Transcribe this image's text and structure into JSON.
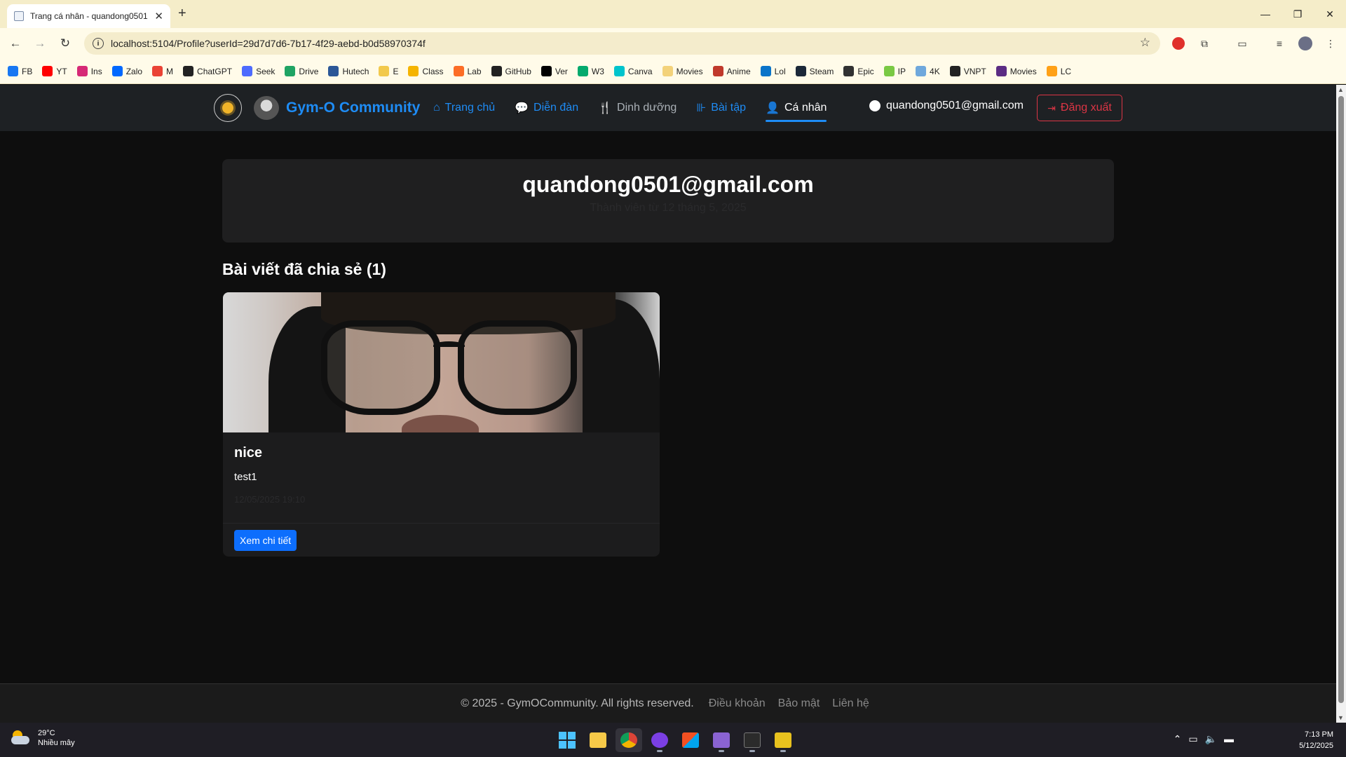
{
  "browser": {
    "tab_title": "Trang cá nhân - quandong0501",
    "url": "localhost:5104/Profile?userId=29d7d7d6-7b17-4f29-aebd-b0d58970374f",
    "bookmarks": [
      {
        "label": "FB",
        "color": "#1877f2"
      },
      {
        "label": "YT",
        "color": "#ff0000"
      },
      {
        "label": "Ins",
        "color": "#d62976"
      },
      {
        "label": "Zalo",
        "color": "#0068ff"
      },
      {
        "label": "M",
        "color": "#ea4335"
      },
      {
        "label": "ChatGPT",
        "color": "#222222"
      },
      {
        "label": "Seek",
        "color": "#4d6bfe"
      },
      {
        "label": "Drive",
        "color": "#1fa463"
      },
      {
        "label": "Hutech",
        "color": "#2b5797"
      },
      {
        "label": "E",
        "color": "#f2c94c"
      },
      {
        "label": "Class",
        "color": "#f5b400"
      },
      {
        "label": "Lab",
        "color": "#fc6d26"
      },
      {
        "label": "GitHub",
        "color": "#222222"
      },
      {
        "label": "Ver",
        "color": "#000000"
      },
      {
        "label": "W3",
        "color": "#04aa6d"
      },
      {
        "label": "Canva",
        "color": "#00c4cc"
      },
      {
        "label": "Movies",
        "color": "#f3d27a"
      },
      {
        "label": "Anime",
        "color": "#c0392b"
      },
      {
        "label": "Lol",
        "color": "#0a74c9"
      },
      {
        "label": "Steam",
        "color": "#1b2838"
      },
      {
        "label": "Epic",
        "color": "#313131"
      },
      {
        "label": "IP",
        "color": "#7ac943"
      },
      {
        "label": "4K",
        "color": "#6fa8dc"
      },
      {
        "label": "VNPT",
        "color": "#222222"
      },
      {
        "label": "Movies",
        "color": "#5b2c83"
      },
      {
        "label": "LC",
        "color": "#ffa116"
      }
    ]
  },
  "navbar": {
    "brand": "Gym-O Community",
    "links": [
      {
        "label": "Trang chủ",
        "icon": "home-icon",
        "glyph": "⌂",
        "style": "blue"
      },
      {
        "label": "Diễn đàn",
        "icon": "comments-icon",
        "glyph": "💬",
        "style": "blue"
      },
      {
        "label": "Dinh dưỡng",
        "icon": "utensils-icon",
        "glyph": "🍴",
        "style": "gray"
      },
      {
        "label": "Bài tập",
        "icon": "dumbbell-icon",
        "glyph": "⊪",
        "style": "blue"
      },
      {
        "label": "Cá nhân",
        "icon": "user-icon",
        "glyph": "👤",
        "style": "active"
      }
    ],
    "user_email": "quandong0501@gmail.com",
    "logout_label": "Đăng xuất",
    "accent": "#1e8cf5"
  },
  "profile": {
    "heading": "quandong0501@gmail.com",
    "subtitle": "Thành viên từ 12 tháng 5, 2025"
  },
  "posts_section": {
    "title": "Bài viết đã chia sẻ (1)"
  },
  "post": {
    "title": "nice",
    "content": "test1",
    "meta": "12/05/2025 19:10",
    "detail_button": "Xem chi tiết"
  },
  "footer": {
    "copyright": "© 2025 - GymOCommunity. All rights reserved.",
    "links": [
      "Điều khoản",
      "Bảo mật",
      "Liên hệ"
    ]
  },
  "taskbar": {
    "temperature": "29°C",
    "weather": "Nhiều mây",
    "time": "7:13 PM",
    "date": "5/12/2025"
  }
}
